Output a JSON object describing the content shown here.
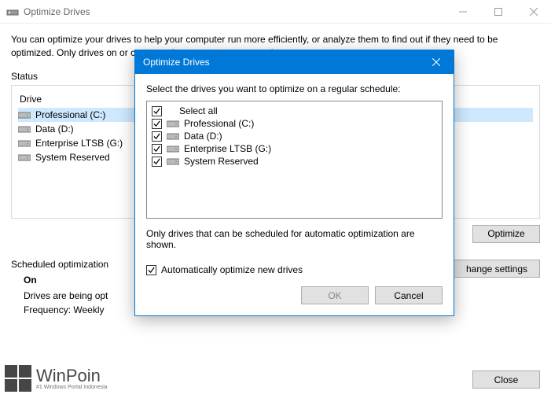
{
  "main": {
    "title": "Optimize Drives",
    "description": "You can optimize your drives to help your computer run more efficiently, or analyze them to find out if they need to be optimized. Only drives on or connected to your computer are shown.",
    "status_label": "Status",
    "drive_header": "Drive",
    "drives": [
      {
        "name": "Professional (C:)",
        "selected": true
      },
      {
        "name": "Data (D:)",
        "selected": false
      },
      {
        "name": "Enterprise LTSB (G:)",
        "selected": false
      },
      {
        "name": "System Reserved",
        "selected": false
      }
    ],
    "optimize_btn": "Optimize",
    "sched_label": "Scheduled optimization",
    "sched_on": "On",
    "sched_desc": "Drives are being opt",
    "sched_freq": "Frequency: Weekly",
    "change_settings_btn": "hange settings",
    "close_btn": "Close"
  },
  "dialog": {
    "title": "Optimize Drives",
    "desc": "Select the drives you want to optimize on a regular schedule:",
    "select_all": "Select all",
    "items": [
      {
        "name": "Professional (C:)"
      },
      {
        "name": "Data (D:)"
      },
      {
        "name": "Enterprise LTSB (G:)"
      },
      {
        "name": "System Reserved"
      }
    ],
    "note": "Only drives that can be scheduled for automatic optimization are shown.",
    "auto_new": "Automatically optimize new drives",
    "ok_btn": "OK",
    "cancel_btn": "Cancel"
  },
  "watermark": {
    "name": "WinPoin",
    "tag": "#1 Windows Portal Indonesia"
  }
}
